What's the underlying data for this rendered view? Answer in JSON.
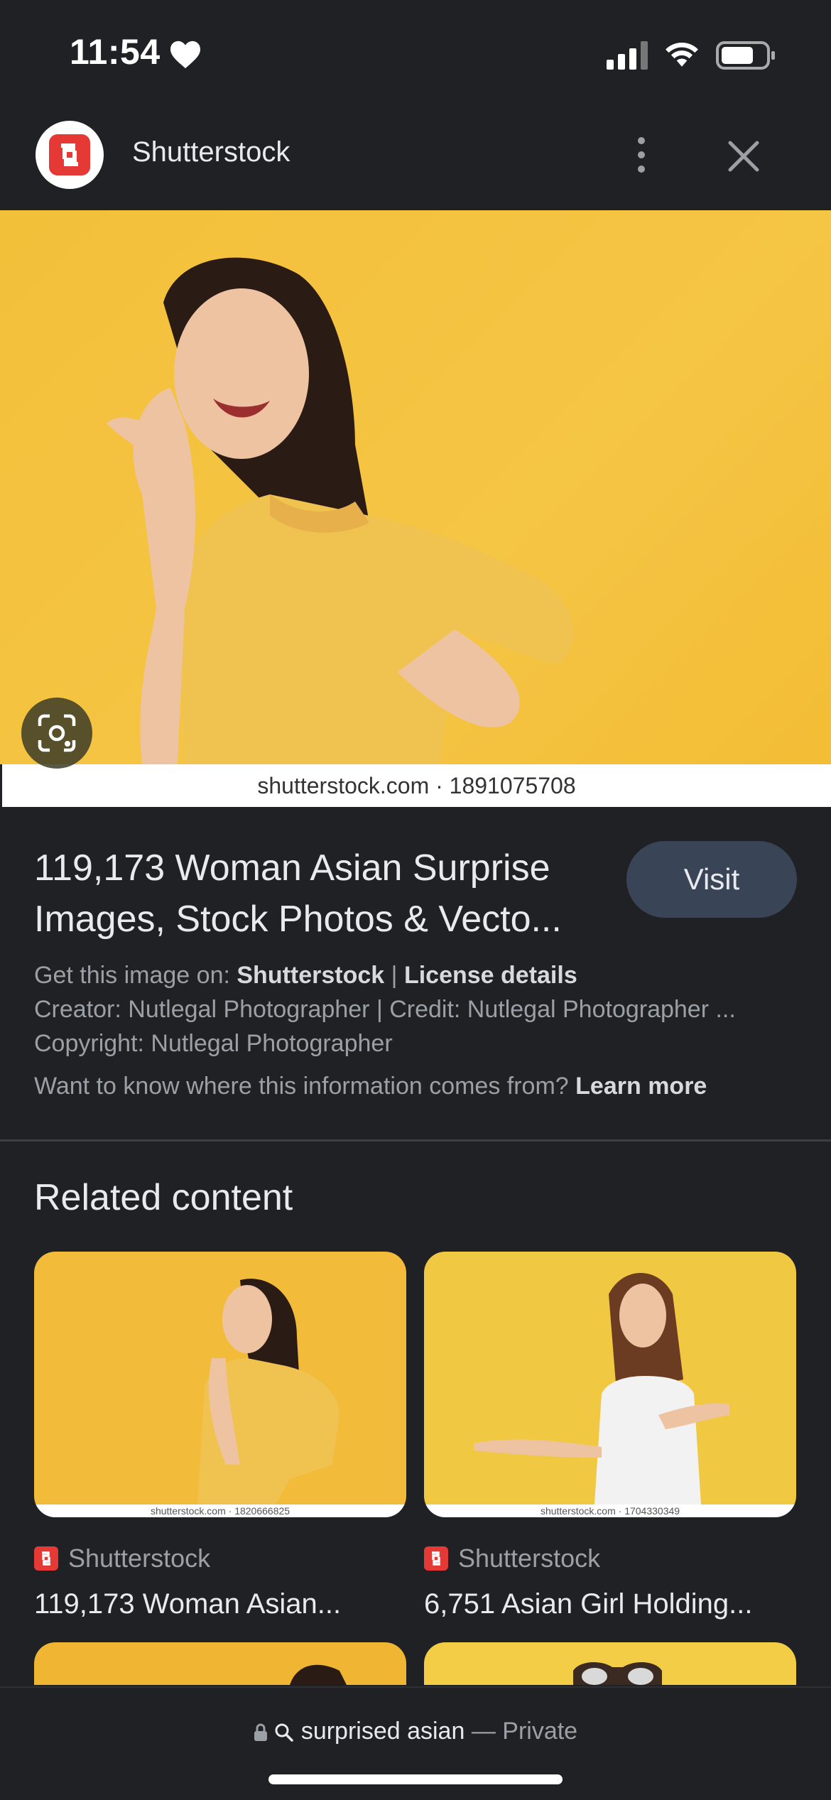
{
  "status_bar": {
    "time": "11:54"
  },
  "header": {
    "title": "Shutterstock"
  },
  "hero": {
    "caption": "shutterstock.com · 1891075708"
  },
  "result": {
    "title": "119,173 Woman Asian Surprise Images, Stock Photos & Vecto...",
    "visit_label": "Visit",
    "get_image_prefix": "Get this image on:",
    "get_image_source": "Shutterstock",
    "separator": "|",
    "license_label": "License details",
    "creator_line": "Creator: Nutlegal Photographer | Credit: Nutlegal Photographer ...",
    "copyright_line": "Copyright: Nutlegal Photographer",
    "info_question": "Want to know where this information comes from?",
    "learn_more": "Learn more"
  },
  "related": {
    "heading": "Related content",
    "cards": [
      {
        "caption": "shutterstock.com · 1820666825",
        "source": "Shutterstock",
        "title": "119,173 Woman Asian..."
      },
      {
        "caption": "shutterstock.com · 1704330349",
        "source": "Shutterstock",
        "title": "6,751 Asian Girl Holding..."
      }
    ]
  },
  "bottom": {
    "query": "surprised asian",
    "mode": "— Private"
  },
  "colors": {
    "background": "#202124",
    "brand_red": "#e53935",
    "visit_button": "#394457",
    "photo_yellow": "#f3c03a"
  },
  "icons": [
    "heart-icon",
    "signal-icon",
    "wifi-icon",
    "battery-icon",
    "shutterstock-logo-icon",
    "more-vert-icon",
    "close-icon",
    "lens-icon",
    "lock-icon",
    "search-icon"
  ]
}
